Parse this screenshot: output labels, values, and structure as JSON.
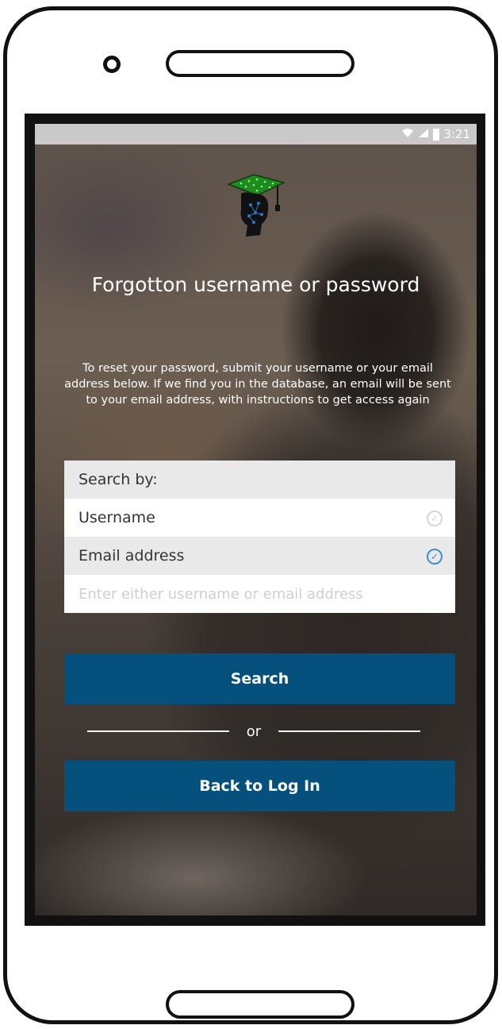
{
  "status_bar": {
    "time": "3:21",
    "icons": [
      "wifi-icon",
      "signal-icon",
      "battery-icon"
    ]
  },
  "title": "Forgotton username or password",
  "description": "To reset your password, submit your username or your email address below. If we find you in the database, an email will be sent to your email address, with instructions to get access again",
  "search_panel": {
    "header": "Search by:",
    "options": [
      {
        "label": "Username",
        "selected": false
      },
      {
        "label": "Email address",
        "selected": true
      }
    ],
    "input": {
      "value": "",
      "placeholder": "Enter either username or email address"
    }
  },
  "buttons": {
    "search": "Search",
    "back": "Back to Log In"
  },
  "divider": "or",
  "colors": {
    "button": "#05507c",
    "check_selected": "#3b8fd4",
    "check_unselected": "#d6d6d6"
  }
}
